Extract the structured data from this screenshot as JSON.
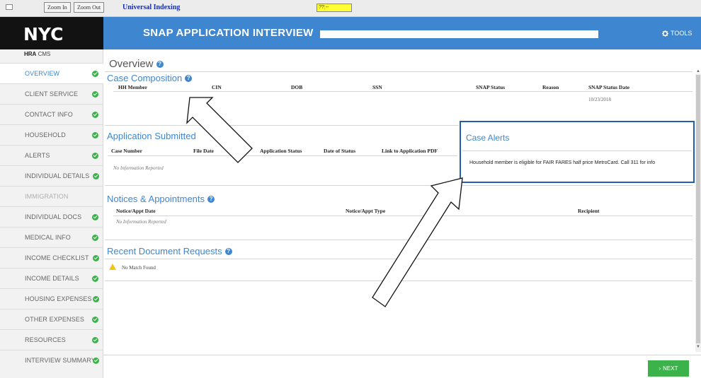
{
  "toolbar": {
    "zoom_in": "Zoom In",
    "zoom_out": "Zoom Out",
    "indexing_link": "Universal Indexing",
    "yellow_field": "??:--"
  },
  "header": {
    "logo": "NYC",
    "title": "SNAP APPLICATION INTERVIEW",
    "tools": "TOOLS",
    "brand_color": "#3f86d1"
  },
  "sidebar": {
    "org_bold": "HRA",
    "org_rest": " CMS",
    "items": [
      {
        "label": "OVERVIEW",
        "state": "active",
        "complete": true
      },
      {
        "label": "CLIENT SERVICE",
        "state": "normal",
        "complete": true
      },
      {
        "label": "CONTACT INFO",
        "state": "normal",
        "complete": true
      },
      {
        "label": "HOUSEHOLD",
        "state": "normal",
        "complete": true
      },
      {
        "label": "ALERTS",
        "state": "normal",
        "complete": true
      },
      {
        "label": "INDIVIDUAL DETAILS",
        "state": "normal",
        "complete": true
      },
      {
        "label": "IMMIGRATION",
        "state": "disabled",
        "complete": false
      },
      {
        "label": "INDIVIDUAL DOCS",
        "state": "normal",
        "complete": true
      },
      {
        "label": "MEDICAL INFO",
        "state": "normal",
        "complete": true
      },
      {
        "label": "INCOME CHECKLIST",
        "state": "normal",
        "complete": true
      },
      {
        "label": "INCOME DETAILS",
        "state": "normal",
        "complete": true
      },
      {
        "label": "HOUSING EXPENSES",
        "state": "normal",
        "complete": true
      },
      {
        "label": "OTHER EXPENSES",
        "state": "normal",
        "complete": true
      },
      {
        "label": "RESOURCES",
        "state": "normal",
        "complete": true
      },
      {
        "label": "INTERVIEW SUMMARY",
        "state": "normal",
        "complete": true
      }
    ]
  },
  "main": {
    "page_title": "Overview",
    "case_composition": {
      "title": "Case Composition",
      "columns": [
        "HH Member",
        "CIN",
        "DOB",
        "SSN",
        "SNAP Status",
        "Reason",
        "SNAP Status Date"
      ],
      "rows": [
        [
          "",
          "",
          "",
          "",
          "",
          "",
          "10/23/2018"
        ]
      ]
    },
    "application_submitted": {
      "title": "Application Submitted",
      "columns": [
        "Case Number",
        "File Date",
        "Application Status",
        "Date of Status",
        "Link to Application PDF"
      ],
      "empty_text": "No Information Reported"
    },
    "case_alerts": {
      "title": "Case Alerts",
      "message": "Household member is eligible for FAIR FARES half price MetroCard. Call 311 for info"
    },
    "notices": {
      "title": "Notices & Appointments",
      "columns": [
        "Notice/Appt Date",
        "Notice/Appt Type",
        "Recipient"
      ],
      "empty_text": "No Information Reported"
    },
    "document_requests": {
      "title": "Recent Document Requests",
      "empty_text": "No Match Found",
      "warning_icon": "warning-icon"
    },
    "next_label": "NEXT"
  }
}
